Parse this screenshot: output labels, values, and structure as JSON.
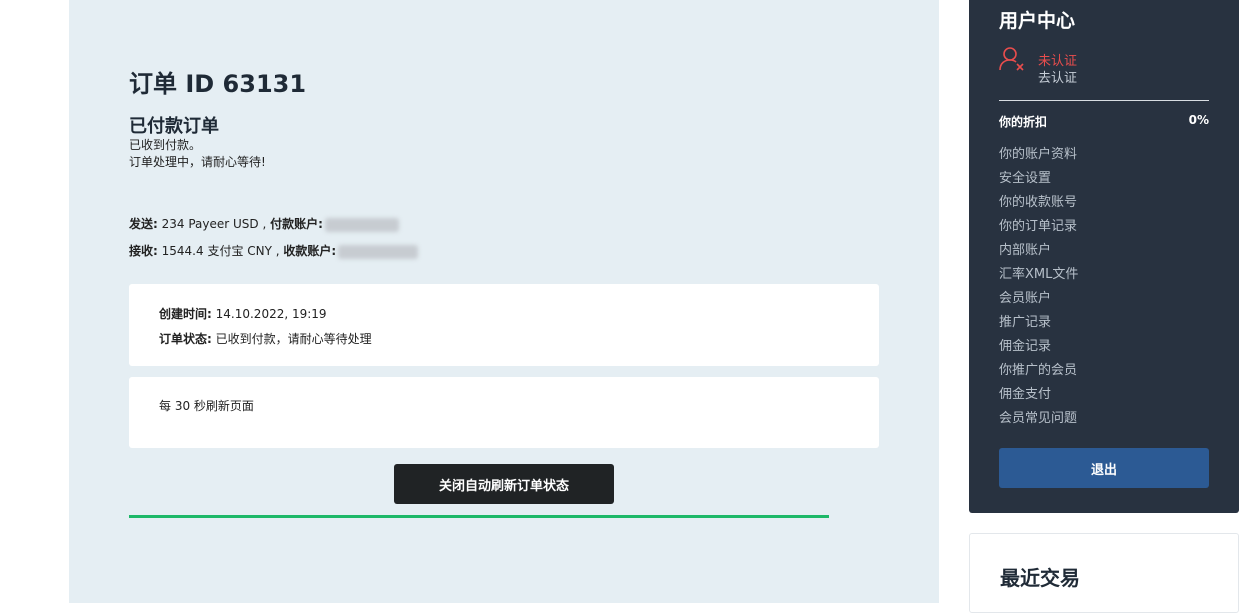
{
  "order": {
    "title": "订单 ID 63131",
    "status_title": "已付款订单",
    "status_line1": "已收到付款。",
    "status_line2": "订单处理中，请耐心等待!",
    "send_label": "发送:",
    "send_value": "234 Payeer USD ,",
    "pay_account_label": "付款账户:",
    "receive_label": "接收:",
    "receive_value": "1544.4 支付宝 CNY ,",
    "receive_account_label": "收款账户:"
  },
  "info_card": {
    "created_label": "创建时间:",
    "created_value": "14.10.2022, 19:19",
    "status_label": "订单状态:",
    "status_value": "已收到付款，请耐心等待处理"
  },
  "refresh_card": {
    "text": "每 30 秒刷新页面"
  },
  "toggle_button": "关闭自动刷新订单状态",
  "progress": {
    "fraction": 1.0,
    "color": "#1db868"
  },
  "sidebar": {
    "title": "用户中心",
    "user_icon": "user-unverified-icon",
    "verify_status": "未认证",
    "verify_link": "去认证",
    "discount_label": "你的折扣",
    "discount_value": "0%",
    "menu": [
      {
        "label": "你的账户资料"
      },
      {
        "label": "安全设置"
      },
      {
        "label": "你的收款账号"
      },
      {
        "label": "你的订单记录"
      },
      {
        "label": "内部账户"
      },
      {
        "label": "汇率XML文件"
      },
      {
        "label": "会员账户"
      },
      {
        "label": "推广记录"
      },
      {
        "label": "佣金记录"
      },
      {
        "label": "你推广的会员"
      },
      {
        "label": "佣金支付"
      },
      {
        "label": "会员常见问题"
      }
    ],
    "logout": "退出"
  },
  "recent": {
    "title": "最近交易"
  },
  "colors": {
    "main_bg": "#e5eef3",
    "sidebar_bg": "#283240",
    "accent_blue": "#2c5a94",
    "alert_red": "#e84d4d",
    "progress_green": "#1db868"
  }
}
